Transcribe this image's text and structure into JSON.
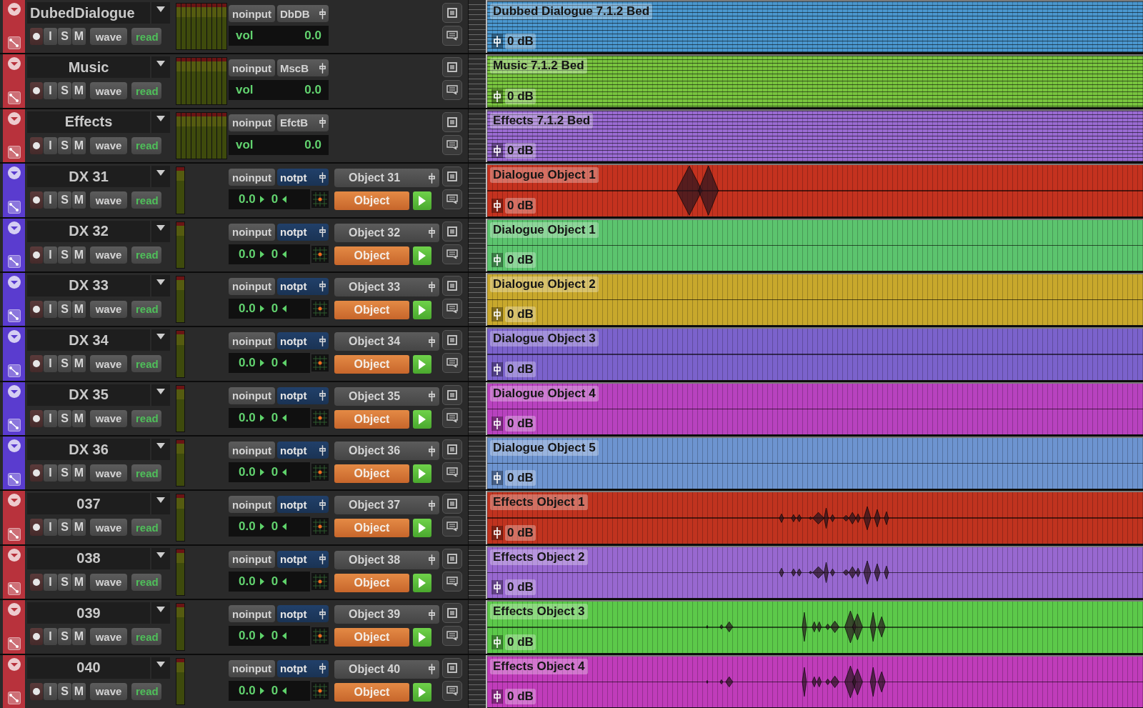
{
  "tracks": [
    {
      "kind": "bed",
      "name": "DubedDialogue",
      "color": "#b8323c",
      "input": "noinput",
      "output": "DbDB",
      "monitor": "I",
      "solo": "S",
      "mute": "M",
      "view": "wave",
      "automation": "read",
      "vol_label": "vol",
      "vol_value": "0.0",
      "clip": {
        "name": "Dubbed Dialogue 7.1.2 Bed",
        "gain": "0 dB",
        "color": "#4a97cf",
        "kind": "empty"
      }
    },
    {
      "kind": "bed",
      "name": "Music",
      "color": "#b8323c",
      "input": "noinput",
      "output": "MscB",
      "monitor": "I",
      "solo": "S",
      "mute": "M",
      "view": "wave",
      "automation": "read",
      "vol_label": "vol",
      "vol_value": "0.0",
      "clip": {
        "name": "Music 7.1.2 Bed",
        "gain": "0 dB",
        "color": "#78c43e",
        "kind": "empty"
      }
    },
    {
      "kind": "bed",
      "name": "Effects",
      "color": "#b8323c",
      "input": "noinput",
      "output": "EfctB",
      "monitor": "I",
      "solo": "S",
      "mute": "M",
      "view": "wave",
      "automation": "read",
      "vol_label": "vol",
      "vol_value": "0.0",
      "clip": {
        "name": "Effects 7.1.2 Bed",
        "gain": "0 dB",
        "color": "#9a6bd2",
        "kind": "empty"
      }
    },
    {
      "kind": "object",
      "name": "DX 31",
      "color": "#5a3ccf",
      "input": "noinput",
      "output": "notpt",
      "monitor": "I",
      "solo": "S",
      "mute": "M",
      "view": "wave",
      "automation": "read",
      "volume": "0.0",
      "pan": "0",
      "object_bus": "Object 31",
      "object_mode": "Object",
      "clip": {
        "name": "Dialogue Object 1",
        "gain": "0 dB",
        "color": "#c4321f",
        "kind": "speech"
      }
    },
    {
      "kind": "object",
      "name": "DX 32",
      "color": "#5a3ccf",
      "input": "noinput",
      "output": "notpt",
      "monitor": "I",
      "solo": "S",
      "mute": "M",
      "view": "wave",
      "automation": "read",
      "volume": "0.0",
      "pan": "0",
      "object_bus": "Object 32",
      "object_mode": "Object",
      "clip": {
        "name": "Dialogue Object 1",
        "gain": "0 dB",
        "color": "#5cc46e",
        "kind": "empty"
      }
    },
    {
      "kind": "object",
      "name": "DX 33",
      "color": "#5a3ccf",
      "input": "noinput",
      "output": "notpt",
      "monitor": "I",
      "solo": "S",
      "mute": "M",
      "view": "wave",
      "automation": "read",
      "volume": "0.0",
      "pan": "0",
      "object_bus": "Object 33",
      "object_mode": "Object",
      "clip": {
        "name": "Dialogue Object 2",
        "gain": "0 dB",
        "color": "#c8a82c",
        "kind": "empty"
      }
    },
    {
      "kind": "object",
      "name": "DX 34",
      "color": "#5a3ccf",
      "input": "noinput",
      "output": "notpt",
      "monitor": "I",
      "solo": "S",
      "mute": "M",
      "view": "wave",
      "automation": "read",
      "volume": "0.0",
      "pan": "0",
      "object_bus": "Object 34",
      "object_mode": "Object",
      "clip": {
        "name": "Dialogue Object 3",
        "gain": "0 dB",
        "color": "#7b62cc",
        "kind": "empty"
      }
    },
    {
      "kind": "object",
      "name": "DX 35",
      "color": "#5a3ccf",
      "input": "noinput",
      "output": "notpt",
      "monitor": "I",
      "solo": "S",
      "mute": "M",
      "view": "wave",
      "automation": "read",
      "volume": "0.0",
      "pan": "0",
      "object_bus": "Object 35",
      "object_mode": "Object",
      "clip": {
        "name": "Dialogue Object 4",
        "gain": "0 dB",
        "color": "#b842bf",
        "kind": "empty"
      }
    },
    {
      "kind": "object",
      "name": "DX 36",
      "color": "#5a3ccf",
      "input": "noinput",
      "output": "notpt",
      "monitor": "I",
      "solo": "S",
      "mute": "M",
      "view": "wave",
      "automation": "read",
      "volume": "0.0",
      "pan": "0",
      "object_bus": "Object 36",
      "object_mode": "Object",
      "clip": {
        "name": "Dialogue Object 5",
        "gain": "0 dB",
        "color": "#6d94d0",
        "kind": "empty"
      }
    },
    {
      "kind": "object",
      "name": "037",
      "color": "#b8323c",
      "input": "noinput",
      "output": "notpt",
      "monitor": "I",
      "solo": "S",
      "mute": "M",
      "view": "wave",
      "automation": "read",
      "volume": "0.0",
      "pan": "0",
      "object_bus": "Object 37",
      "object_mode": "Object",
      "clip": {
        "name": "Effects Object 1",
        "gain": "0 dB",
        "color": "#c0331f",
        "kind": "bursts"
      }
    },
    {
      "kind": "object",
      "name": "038",
      "color": "#b8323c",
      "input": "noinput",
      "output": "notpt",
      "monitor": "I",
      "solo": "S",
      "mute": "M",
      "view": "wave",
      "automation": "read",
      "volume": "0.0",
      "pan": "0",
      "object_bus": "Object 38",
      "object_mode": "Object",
      "clip": {
        "name": "Effects Object 2",
        "gain": "0 dB",
        "color": "#9868d0",
        "kind": "bursts"
      }
    },
    {
      "kind": "object",
      "name": "039",
      "color": "#b8323c",
      "input": "noinput",
      "output": "notpt",
      "monitor": "I",
      "solo": "S",
      "mute": "M",
      "view": "wave",
      "automation": "read",
      "volume": "0.0",
      "pan": "0",
      "object_bus": "Object 39",
      "object_mode": "Object",
      "clip": {
        "name": "Effects Object 3",
        "gain": "0 dB",
        "color": "#5cc94a",
        "kind": "hits"
      }
    },
    {
      "kind": "object",
      "name": "040",
      "color": "#b8323c",
      "input": "noinput",
      "output": "notpt",
      "monitor": "I",
      "solo": "S",
      "mute": "M",
      "view": "wave",
      "automation": "read",
      "volume": "0.0",
      "pan": "0",
      "object_bus": "Object 40",
      "object_mode": "Object",
      "clip": {
        "name": "Effects Object 4",
        "gain": "0 dB",
        "color": "#c03cba",
        "kind": "hits"
      }
    }
  ]
}
